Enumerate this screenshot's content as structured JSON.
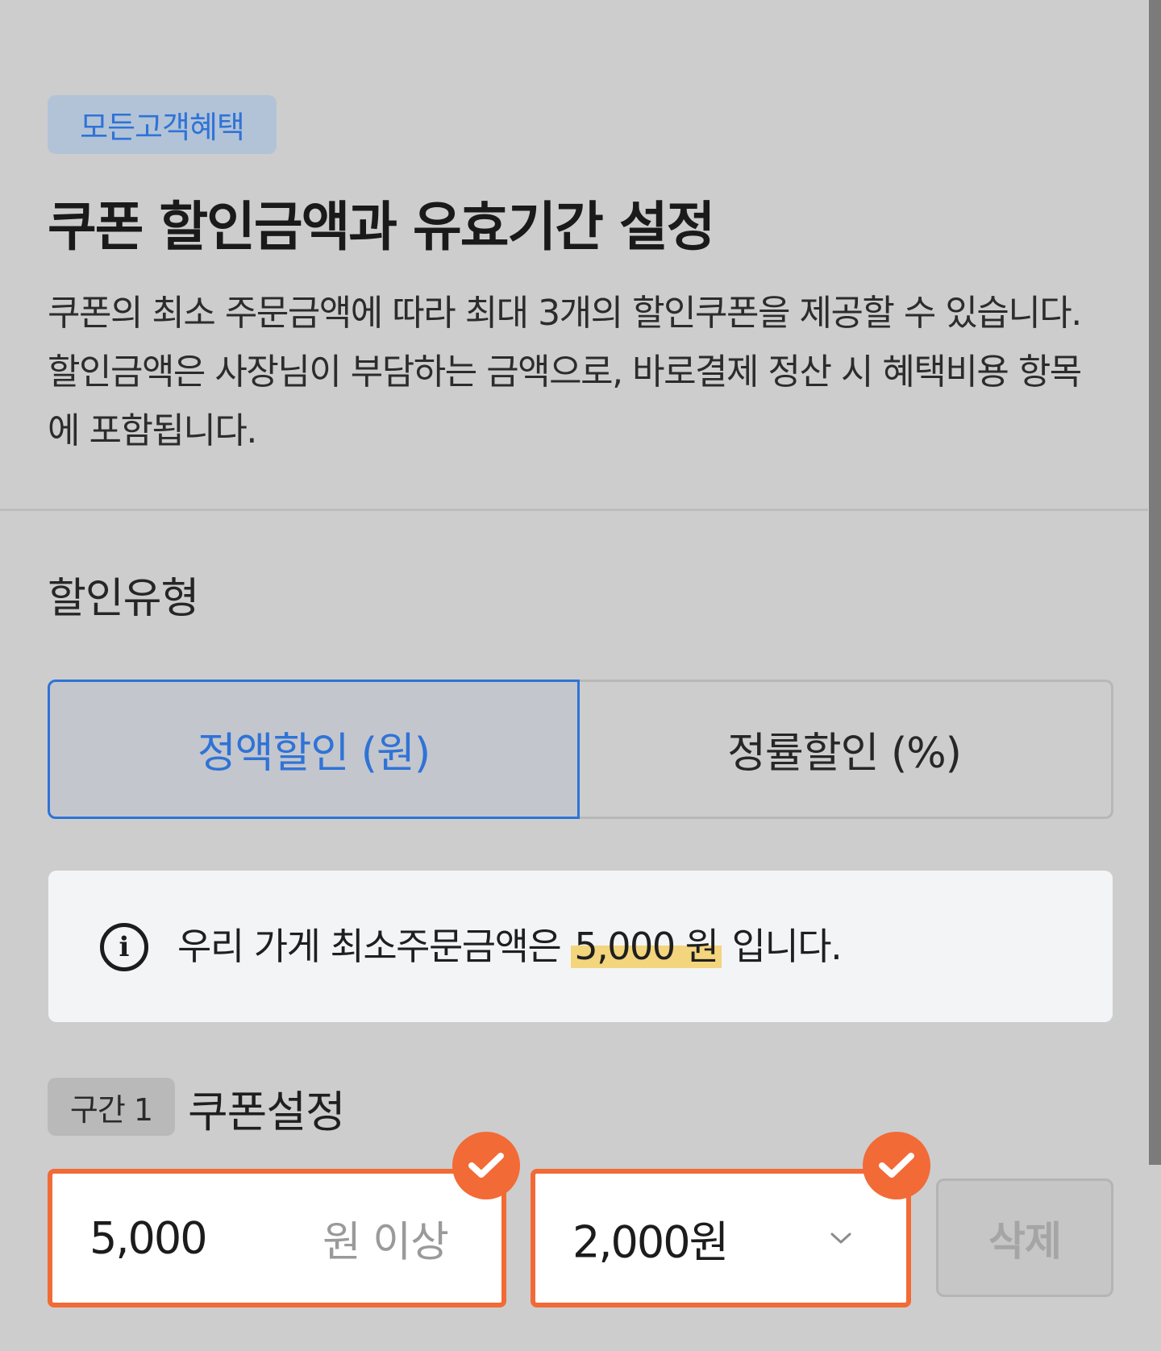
{
  "badge": {
    "label": "모든고객혜택"
  },
  "header": {
    "title": "쿠폰 할인금액과 유효기간 설정",
    "description": "쿠폰의 최소 주문금액에 따라 최대 3개의 할인쿠폰을 제공할 수 있습니다. 할인금액은 사장님이 부담하는 금액으로, 바로결제 정산 시 혜택비용 항목에 포함됩니다."
  },
  "discount_type": {
    "label": "할인유형",
    "options": [
      {
        "label": "정액할인 (원)",
        "selected": true
      },
      {
        "label": "정률할인 (%)",
        "selected": false
      }
    ]
  },
  "info": {
    "icon": "info-icon",
    "text_prefix": "우리 가게 최소주문금액은",
    "amount": "5,000 원",
    "text_suffix": "입니다."
  },
  "tier": {
    "badge": "구간 1",
    "title": "쿠폰설정",
    "min_order": {
      "value": "5,000",
      "suffix": "원 이상",
      "valid": true
    },
    "discount": {
      "value": "2,000원",
      "valid": true
    },
    "delete_label": "삭제"
  },
  "colors": {
    "accent": "#2f73d6",
    "valid": "#f26a36",
    "highlight": "#f3d57d",
    "background": "#cdcdcd"
  }
}
